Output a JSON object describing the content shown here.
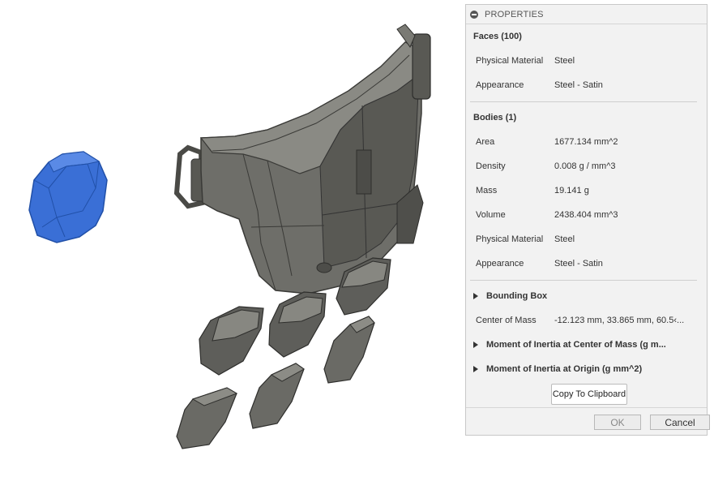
{
  "panel": {
    "title": "PROPERTIES",
    "faces": {
      "title": "Faces (100)",
      "rows": [
        {
          "label": "Physical Material",
          "value": "Steel"
        },
        {
          "label": "Appearance",
          "value": "Steel - Satin"
        }
      ]
    },
    "bodies": {
      "title": "Bodies (1)",
      "rows": [
        {
          "label": "Area",
          "value": "1677.134 mm^2"
        },
        {
          "label": "Density",
          "value": "0.008 g / mm^3"
        },
        {
          "label": "Mass",
          "value": "19.141 g"
        },
        {
          "label": "Volume",
          "value": "2438.404 mm^3"
        },
        {
          "label": "Physical Material",
          "value": "Steel"
        },
        {
          "label": "Appearance",
          "value": "Steel - Satin"
        }
      ]
    },
    "bounding_box": "Bounding Box",
    "center_of_mass": {
      "label": "Center of Mass",
      "value": "-12.123 mm, 33.865 mm, 60.5‹..."
    },
    "moi_center": "Moment of Inertia at Center of Mass   (g m...",
    "moi_origin": "Moment of Inertia at Origin   (g mm^2)",
    "copy_label": "Copy To Clipboard",
    "ok_label": "OK",
    "cancel_label": "Cancel"
  },
  "colors": {
    "selected_body": "#3a6fd6",
    "steel_body": "#5c5c58",
    "panel_bg": "#f2f2f2"
  }
}
